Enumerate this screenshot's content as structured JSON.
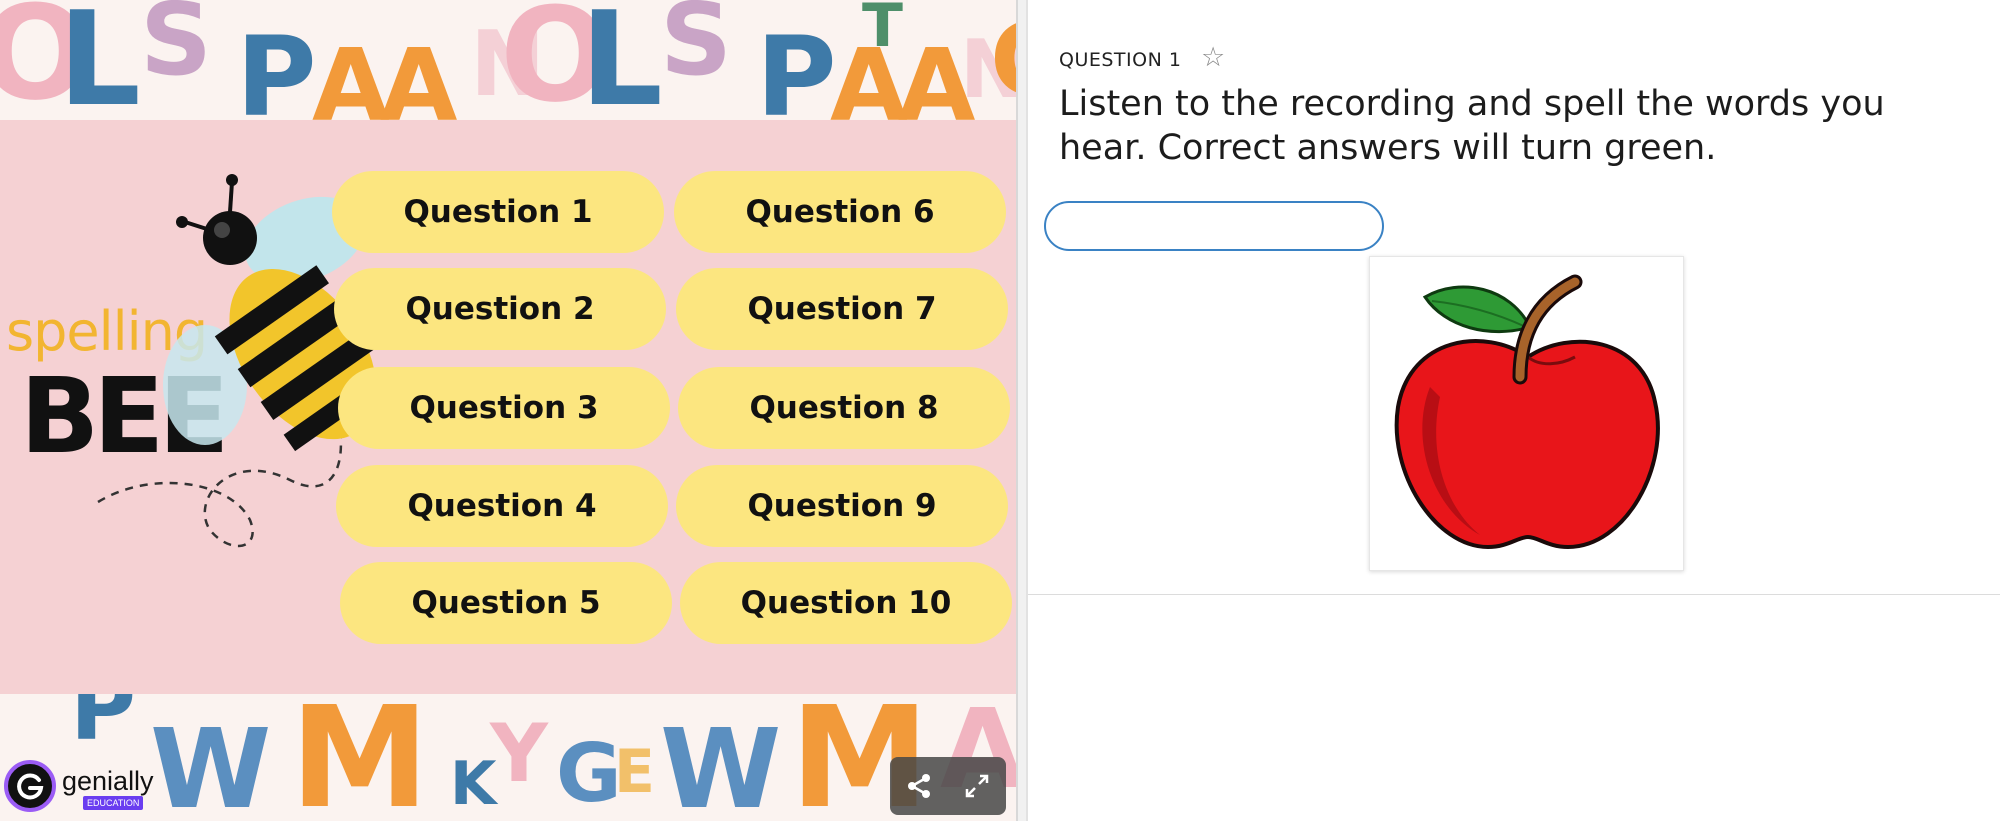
{
  "slide": {
    "buttons": [
      {
        "label": "Question 1"
      },
      {
        "label": "Question 2"
      },
      {
        "label": "Question 3"
      },
      {
        "label": "Question 4"
      },
      {
        "label": "Question 5"
      },
      {
        "label": "Question 6"
      },
      {
        "label": "Question 7"
      },
      {
        "label": "Question 8"
      },
      {
        "label": "Question 9"
      },
      {
        "label": "Question 10"
      }
    ],
    "logo": {
      "spelling": "spelling",
      "bee": "BEE"
    },
    "background_letters_top": [
      "O",
      "L",
      "S",
      "P",
      "A",
      "A",
      "N",
      "O",
      "L",
      "S",
      "P",
      "A",
      "A",
      "T",
      "N",
      "C"
    ],
    "background_letters_bottom": [
      "P",
      "W",
      "M",
      "K",
      "Y",
      "G",
      "E",
      "W",
      "M",
      "A"
    ],
    "colors": {
      "button": "#fce680",
      "slide_bg": "#f5d1d3",
      "spelling": "#f2b531"
    }
  },
  "branding": {
    "name": "genially",
    "tag": "EDUCATION",
    "icon": "genially-logo-icon"
  },
  "controls": {
    "share_icon": "share-icon",
    "fullscreen_icon": "fullscreen-icon"
  },
  "question": {
    "label": "QUESTION 1",
    "text": "Listen to the recording and spell the words you hear. Correct answers will turn green.",
    "answer_value": "",
    "star_icon": "star-icon",
    "image_icon": "apple-icon",
    "input_border_color": "#3a82c4"
  }
}
